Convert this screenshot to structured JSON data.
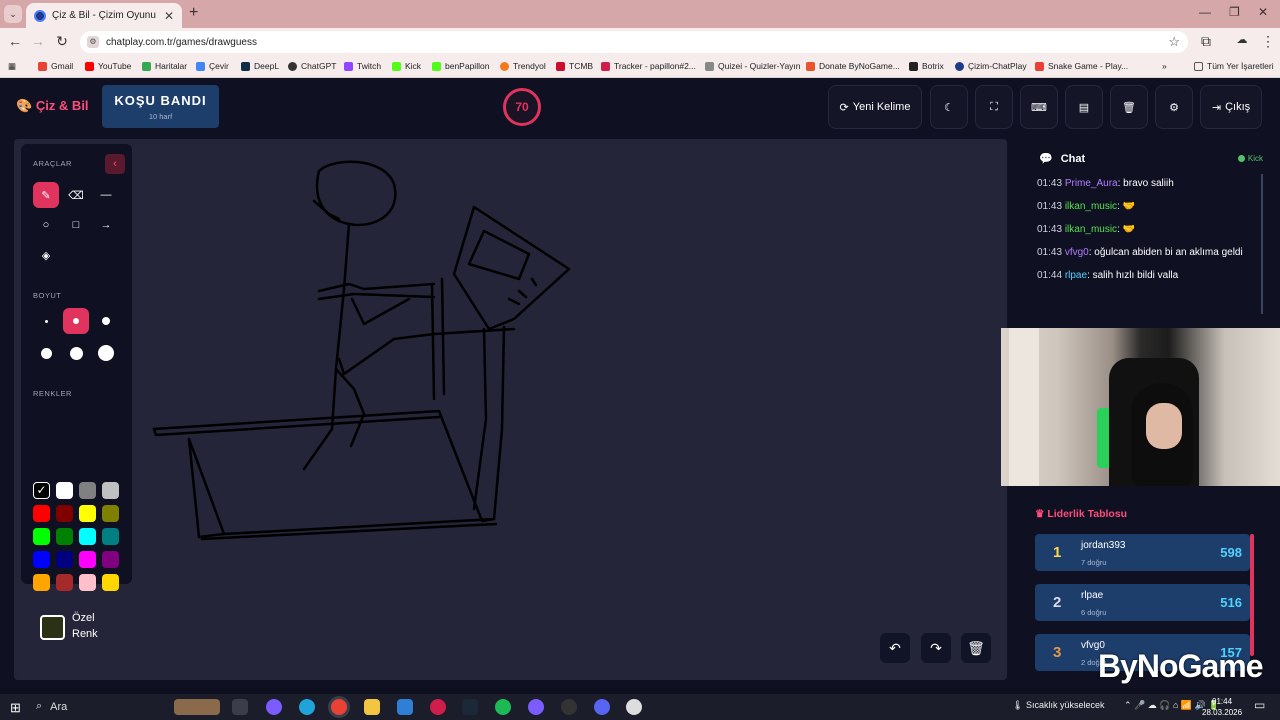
{
  "browser": {
    "tab_title": "Çiz & Bil - Çizim Oyunu",
    "url": "chatplay.com.tr/games/drawguess",
    "bookmarks": [
      "Gmail",
      "YouTube",
      "Haritalar",
      "Çevir",
      "DeepL",
      "ChatGPT",
      "Twitch",
      "Kick",
      "benPapillon",
      "Trendyol",
      "TCMB",
      "Tracker - papillon#2...",
      "Quizei - Quizler-Yayın",
      "Donate ByNoGame...",
      "Botrix",
      "Çizim-ChatPlay",
      "Snake Game - Play..."
    ],
    "all_bookmarks": "Tüm Yer İşaretleri"
  },
  "app": {
    "logo": "Çiz & Bil",
    "word": "KOŞU BANDI",
    "hint": "10 harf",
    "timer": "70",
    "new_word": "Yeni Kelime",
    "logout": "Çıkış"
  },
  "tools": {
    "tools_title": "ARAÇLAR",
    "size_title": "BOYUT",
    "colors_title": "RENKLER",
    "custom_label_1": "Özel",
    "custom_label_2": "Renk",
    "colors": [
      "#000000",
      "#ffffff",
      "#808080",
      "#c0c0c0",
      "#ff0000",
      "#800000",
      "#ffff00",
      "#808000",
      "#00ff00",
      "#008000",
      "#00ffff",
      "#008080",
      "#0000ff",
      "#000080",
      "#ff00ff",
      "#800080",
      "#ffa500",
      "#a52a2a",
      "#ffc0cb",
      "#ffd700"
    ]
  },
  "chat": {
    "title": "Chat",
    "platform": "Kick",
    "messages": [
      {
        "time": "01:43",
        "user": "Prime_Aura",
        "color": "#b37dff",
        "text": ": bravo saliih"
      },
      {
        "time": "01:43",
        "user": "ilkan_music",
        "color": "#53e04b",
        "text": ": 🤝"
      },
      {
        "time": "01:43",
        "user": "ilkan_music",
        "color": "#53e04b",
        "text": ": 🤝"
      },
      {
        "time": "01:43",
        "user": "vfvg0",
        "color": "#b37dff",
        "text": ": oğulcan abiden bi an aklıma geldi"
      },
      {
        "time": "01:44",
        "user": "rlpae",
        "color": "#4fd2ff",
        "text": ": salih hızlı bildi valla"
      }
    ]
  },
  "leaderboard": {
    "title": "Liderlik Tablosu",
    "rows": [
      {
        "rank": "1",
        "name": "jordan393",
        "sub": "7 doğru",
        "score": "598",
        "rank_color": "#ffd84a"
      },
      {
        "rank": "2",
        "name": "rlpae",
        "sub": "6 doğru",
        "score": "516",
        "rank_color": "#d8dce8"
      },
      {
        "rank": "3",
        "name": "vfvg0",
        "sub": "2 doğru",
        "score": "157",
        "rank_color": "#e09a4a"
      }
    ]
  },
  "watermark": "ByNoGame",
  "taskbar": {
    "search": "Ara",
    "weather": "Sıcaklık yükselecek",
    "time": "01:44",
    "date": "28.03.2026"
  }
}
